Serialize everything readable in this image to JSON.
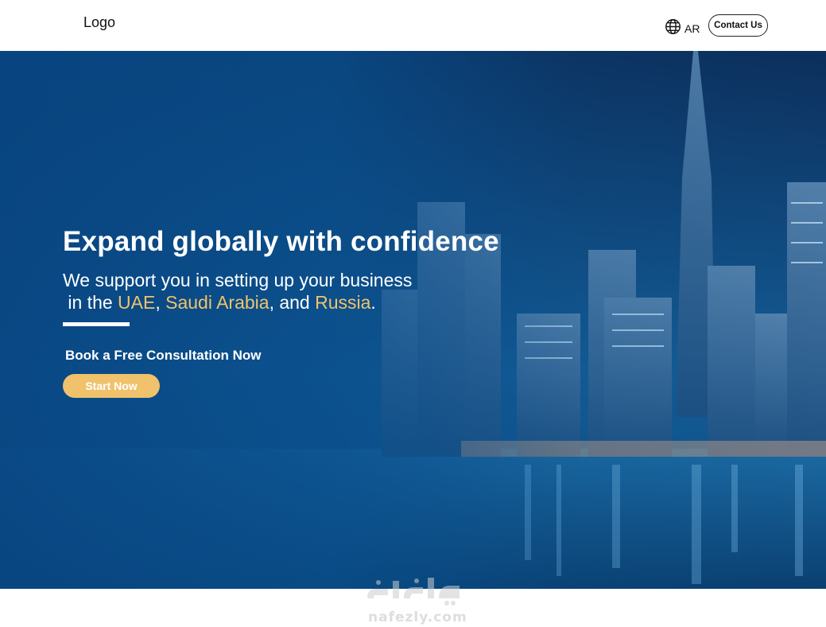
{
  "header": {
    "logo": "Logo",
    "language_icon": "globe-icon",
    "language_label": "AR",
    "contact_label": "Contact Us"
  },
  "hero": {
    "title": "Expand globally with confidence",
    "subtitle_line1": "We support you in setting up your business",
    "subtitle_line2_prefix": " in the ",
    "country1": "UAE",
    "sep1": ", ",
    "country2": "Saudi Arabia",
    "sep2": ", and ",
    "country3": "Russia",
    "end": ".",
    "cta_text": "Book a Free Consultation Now",
    "start_label": "Start Now",
    "highlight_color": "#f0c36c",
    "button_color": "#efc26b"
  },
  "watermark": {
    "text": "nafezly.com"
  }
}
